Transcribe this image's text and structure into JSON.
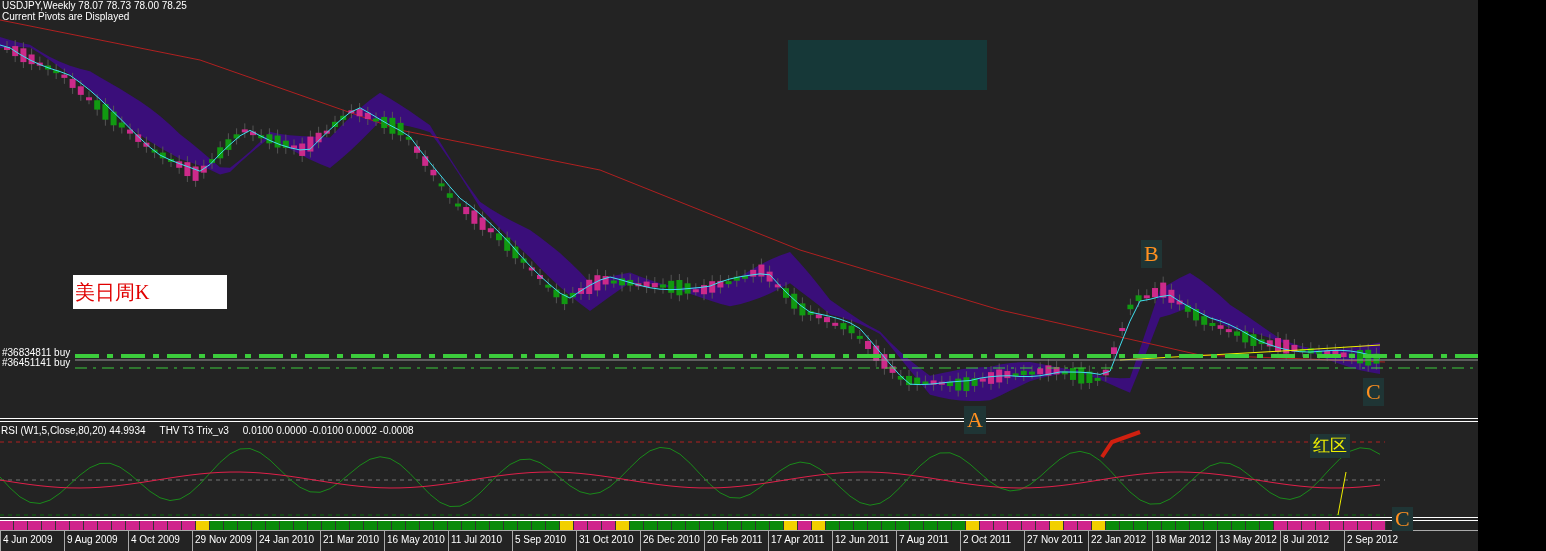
{
  "header": {
    "symbol_line": "USDJPY,Weekly 78.07 78.73 78.00 78.25",
    "pivots_note": "Current Pivots are Displayed"
  },
  "main_chart": {
    "annotation": "美日周K",
    "wave_labels": [
      "B",
      "C",
      "A"
    ]
  },
  "order_lines": [
    {
      "label": "#36834811 buy"
    },
    {
      "label": "#36451141 buy"
    }
  ],
  "indicator_panel": {
    "rsi_label": "RSI (W1,5,Close,80,20) 44.9934",
    "trix_label": "THV T3 Trix_v3",
    "trix_values": "0.0100 0.0000 -0.0100 0.0002 -0.0008",
    "zone_label": "红区"
  },
  "signal_bar": {
    "end_label": "C"
  },
  "time_axis": [
    "4 Jun 2009",
    "9 Aug 2009",
    "4 Oct 2009",
    "29 Nov 2009",
    "24 Jan 2010",
    "21 Mar 2010",
    "16 May 2010",
    "11 Jul 2010",
    "5 Sep 2010",
    "31 Oct 2010",
    "26 Dec 2010",
    "20 Feb 2011",
    "17 Apr 2011",
    "12 Jun 2011",
    "7 Aug 2011",
    "2 Oct 2011",
    "27 Nov 2011",
    "22 Jan 2012",
    "18 Mar 2012",
    "13 May 2012",
    "8 Jul 2012",
    "2 Sep 2012"
  ]
}
